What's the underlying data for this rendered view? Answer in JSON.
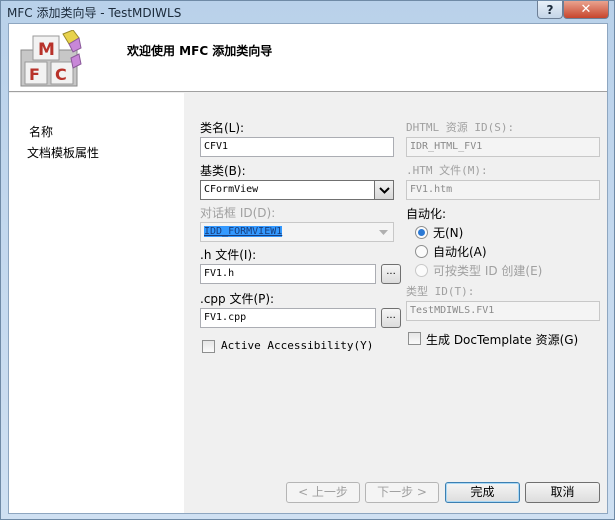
{
  "window": {
    "title": "MFC 添加类向导 - TestMDIWLS",
    "help_label": "?",
    "close_label": "✕"
  },
  "banner": {
    "title": "欢迎使用 MFC 添加类向导",
    "logo_letters": [
      "M",
      "F",
      "C"
    ]
  },
  "sidebar": {
    "items": [
      {
        "label": "名称"
      },
      {
        "label": "文档模板属性"
      }
    ]
  },
  "form": {
    "class_name": {
      "label": "类名(L):",
      "value": "CFV1"
    },
    "base_class": {
      "label": "基类(B):",
      "value": "CFormView"
    },
    "dialog_id": {
      "label": "对话框 ID(D):",
      "value": "IDD_FORMVIEW1"
    },
    "h_file": {
      "label": ".h 文件(I):",
      "value": "FV1.h",
      "browse_label": "..."
    },
    "cpp_file": {
      "label": ".cpp 文件(P):",
      "value": "FV1.cpp",
      "browse_label": "..."
    },
    "active_accessibility": {
      "label": "Active Accessibility(Y)",
      "checked": false
    },
    "dhtml_id": {
      "label": "DHTML 资源 ID(S):",
      "value": "IDR_HTML_FV1"
    },
    "htm_file": {
      "label": ".HTM 文件(M):",
      "value": "FV1.htm"
    },
    "automation": {
      "label": "自动化:",
      "options": [
        {
          "label": "无(N)",
          "selected": true,
          "disabled": false
        },
        {
          "label": "自动化(A)",
          "selected": false,
          "disabled": false
        },
        {
          "label": "可按类型 ID 创建(E)",
          "selected": false,
          "disabled": true
        }
      ]
    },
    "type_id": {
      "label": "类型 ID(T):",
      "value": "TestMDIWLS.FV1"
    },
    "doc_template": {
      "label": "生成 DocTemplate 资源(G)",
      "checked": false
    }
  },
  "buttons": {
    "back": "< 上一步",
    "next": "下一步 >",
    "finish": "完成",
    "cancel": "取消"
  },
  "colors": {
    "accent": "#3399ff",
    "radio_dot": "#2a78d4",
    "titlebar": "#b9d1ea",
    "close": "#c7452d"
  }
}
